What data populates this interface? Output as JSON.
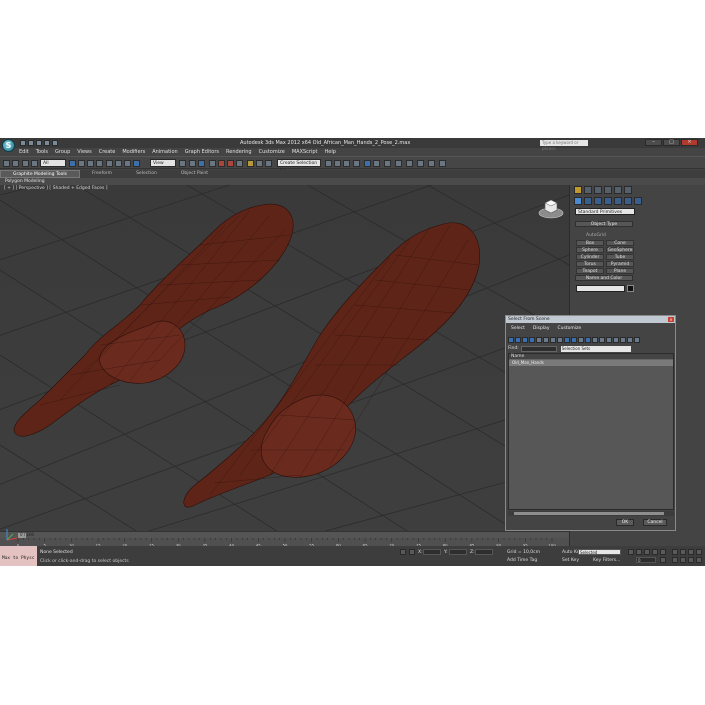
{
  "window": {
    "title": "Autodesk 3ds Max 2012 x64     Old_African_Man_Hands_2_Pose_2.max",
    "search_placeholder": "Type a keyword or phrase"
  },
  "menu": [
    "Edit",
    "Tools",
    "Group",
    "Views",
    "Create",
    "Modifiers",
    "Animation",
    "Graph Editors",
    "Rendering",
    "Customize",
    "MAXScript",
    "Help"
  ],
  "toolbar": {
    "filter_value": "All",
    "ref_coord_value": "View",
    "named_selection_value": "Create Selection Se"
  },
  "ribbon": {
    "tabs": [
      "Graphite Modeling Tools",
      "Freeform",
      "Selection",
      "Object Paint"
    ],
    "subpanel": "Polygon Modeling"
  },
  "viewport": {
    "label": "[ + ] [ Perspective ] [ Shaded + Edged Faces ]"
  },
  "command_panel": {
    "category_value": "Standard Primitives",
    "object_type_header": "Object Type",
    "autogrid_label": "AutoGrid",
    "buttons": [
      "Box",
      "Cone",
      "Sphere",
      "GeoSphere",
      "Cylinder",
      "Tube",
      "Torus",
      "Pyramid",
      "Teapot",
      "Plane"
    ],
    "name_color_header": "Name and Color"
  },
  "dialog": {
    "title": "Select From Scene",
    "menu": [
      "Select",
      "Display",
      "Customize"
    ],
    "find_label": "Find:",
    "selection_sets_value": "Selection Sets",
    "column_header": "Name",
    "items": [
      "Old_Man_Hands"
    ],
    "ok_label": "OK",
    "cancel_label": "Cancel"
  },
  "timeline": {
    "frame_readout": "0 / 100",
    "ticks": [
      "0",
      "5",
      "10",
      "15",
      "20",
      "25",
      "30",
      "35",
      "40",
      "45",
      "50",
      "55",
      "60",
      "65",
      "70",
      "75",
      "80",
      "85",
      "90",
      "95",
      "100"
    ]
  },
  "status": {
    "maxscript_text": "Max to Physc",
    "selection_text": "None Selected",
    "prompt_text": "Click or click-and-drag to select objects",
    "x_label": "X:",
    "y_label": "Y:",
    "z_label": "Z:",
    "grid_text": "Grid = 10,0cm",
    "add_time_tag": "Add Time Tag",
    "auto_key": "Auto Key",
    "key_filter_value": "Selected",
    "set_key": "Set Key",
    "key_filters": "Key Filters...",
    "frame_value": "0"
  },
  "colors": {
    "app_bg": "#444444",
    "viewport_bg": "#3d3d3d",
    "accent": "#c09a2c",
    "skin": "#6b2a1e"
  }
}
